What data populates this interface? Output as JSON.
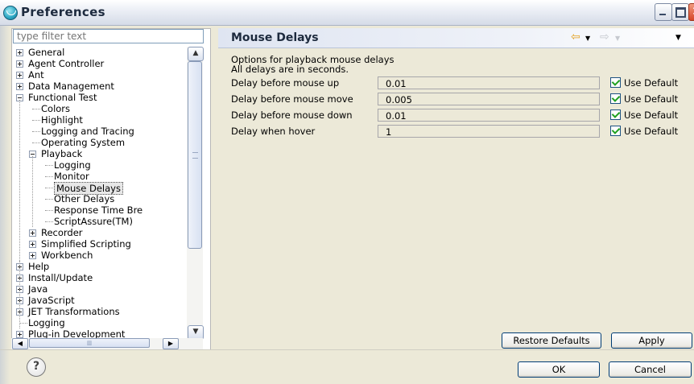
{
  "window": {
    "title": "Preferences"
  },
  "filter": {
    "placeholder": "type filter text"
  },
  "tree": [
    {
      "label": "General",
      "level": 0,
      "expander": "plus"
    },
    {
      "label": "Agent Controller",
      "level": 0,
      "expander": "plus"
    },
    {
      "label": "Ant",
      "level": 0,
      "expander": "plus"
    },
    {
      "label": "Data Management",
      "level": 0,
      "expander": "plus"
    },
    {
      "label": "Functional Test",
      "level": 0,
      "expander": "minus"
    },
    {
      "label": "Colors",
      "level": 1,
      "expander": "none"
    },
    {
      "label": "Highlight",
      "level": 1,
      "expander": "none"
    },
    {
      "label": "Logging and Tracing",
      "level": 1,
      "expander": "none"
    },
    {
      "label": "Operating System",
      "level": 1,
      "expander": "none"
    },
    {
      "label": "Playback",
      "level": 1,
      "expander": "minus"
    },
    {
      "label": "Logging",
      "level": 2,
      "expander": "none"
    },
    {
      "label": "Monitor",
      "level": 2,
      "expander": "none"
    },
    {
      "label": "Mouse Delays",
      "level": 2,
      "expander": "none",
      "selected": true
    },
    {
      "label": "Other Delays",
      "level": 2,
      "expander": "none"
    },
    {
      "label": "Response Time Bre",
      "level": 2,
      "expander": "none"
    },
    {
      "label": "ScriptAssure(TM)",
      "level": 2,
      "expander": "none"
    },
    {
      "label": "Recorder",
      "level": 1,
      "expander": "plus"
    },
    {
      "label": "Simplified Scripting",
      "level": 1,
      "expander": "plus"
    },
    {
      "label": "Workbench",
      "level": 1,
      "expander": "plus"
    },
    {
      "label": "Help",
      "level": 0,
      "expander": "plus"
    },
    {
      "label": "Install/Update",
      "level": 0,
      "expander": "plus"
    },
    {
      "label": "Java",
      "level": 0,
      "expander": "plus"
    },
    {
      "label": "JavaScript",
      "level": 0,
      "expander": "plus"
    },
    {
      "label": "JET Transformations",
      "level": 0,
      "expander": "plus"
    },
    {
      "label": "Logging",
      "level": 0,
      "expander": "none"
    },
    {
      "label": "Plug-in Development",
      "level": 0,
      "expander": "plus"
    }
  ],
  "page": {
    "title": "Mouse Delays",
    "description": "Options for playback mouse delays",
    "note": "All delays are in seconds.",
    "settings": [
      {
        "label": "Delay before mouse up",
        "value": "0.01",
        "checkbox": "Use Default"
      },
      {
        "label": "Delay before mouse move",
        "value": "0.005",
        "checkbox": "Use Default"
      },
      {
        "label": "Delay before mouse down",
        "value": "0.01",
        "checkbox": "Use Default"
      },
      {
        "label": "Delay when hover",
        "value": "1",
        "checkbox": "Use Default"
      }
    ],
    "restore_label": "Restore Defaults",
    "apply_label": "Apply"
  },
  "footer": {
    "ok_label": "OK",
    "cancel_label": "Cancel",
    "help_glyph": "?"
  },
  "icons": {
    "back": "back-arrow-icon",
    "forward": "forward-arrow-icon",
    "menu": "view-menu-icon"
  },
  "colors": {
    "accent": "#003c74",
    "checkmark": "#21a121",
    "panel": "#ece9d8"
  }
}
